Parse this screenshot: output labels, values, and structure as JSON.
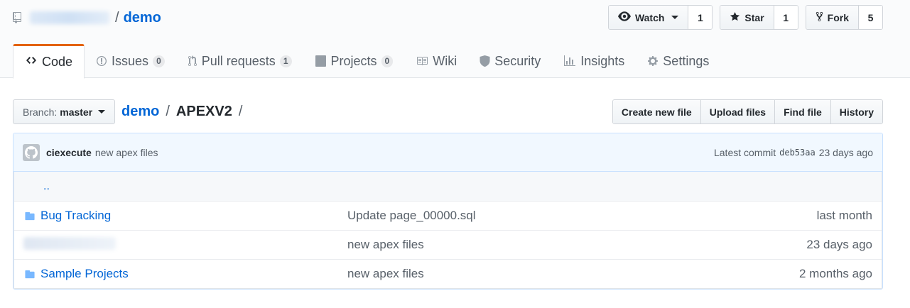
{
  "repo": {
    "owner_redacted": "",
    "name": "demo"
  },
  "actions": {
    "watch": {
      "label": "Watch",
      "count": "1"
    },
    "star": {
      "label": "Star",
      "count": "1"
    },
    "fork": {
      "label": "Fork",
      "count": "5"
    }
  },
  "tabs": [
    {
      "label": "Code",
      "icon": "code-icon",
      "count": null
    },
    {
      "label": "Issues",
      "icon": "issue-icon",
      "count": "0"
    },
    {
      "label": "Pull requests",
      "icon": "pull-request-icon",
      "count": "1"
    },
    {
      "label": "Projects",
      "icon": "project-icon",
      "count": "0"
    },
    {
      "label": "Wiki",
      "icon": "book-icon",
      "count": null
    },
    {
      "label": "Security",
      "icon": "shield-icon",
      "count": null
    },
    {
      "label": "Insights",
      "icon": "graph-icon",
      "count": null
    },
    {
      "label": "Settings",
      "icon": "gear-icon",
      "count": null
    }
  ],
  "branch": {
    "label": "Branch:",
    "value": "master"
  },
  "breadcrumb": {
    "root": "demo",
    "sep1": "/",
    "folder": "APEXV2",
    "sep2": "/"
  },
  "file_actions": [
    "Create new file",
    "Upload files",
    "Find file",
    "History"
  ],
  "commit": {
    "author": "ciexecute",
    "message": "new apex files",
    "latest_label": "Latest commit",
    "sha": "deb53aa",
    "age": "23 days ago"
  },
  "files": {
    "up": "..",
    "rows": [
      {
        "name": "Bug Tracking",
        "message": "Update page_00000.sql",
        "age": "last month",
        "redacted": false
      },
      {
        "name": "",
        "message": "new apex files",
        "age": "23 days ago",
        "redacted": true
      },
      {
        "name": "Sample Projects",
        "message": "new apex files",
        "age": "2 months ago",
        "redacted": false
      }
    ]
  },
  "colors": {
    "link": "#0366d6",
    "accent_tab": "#e36209",
    "commit_bg": "#f1f8ff",
    "folder": "#79b8ff"
  }
}
